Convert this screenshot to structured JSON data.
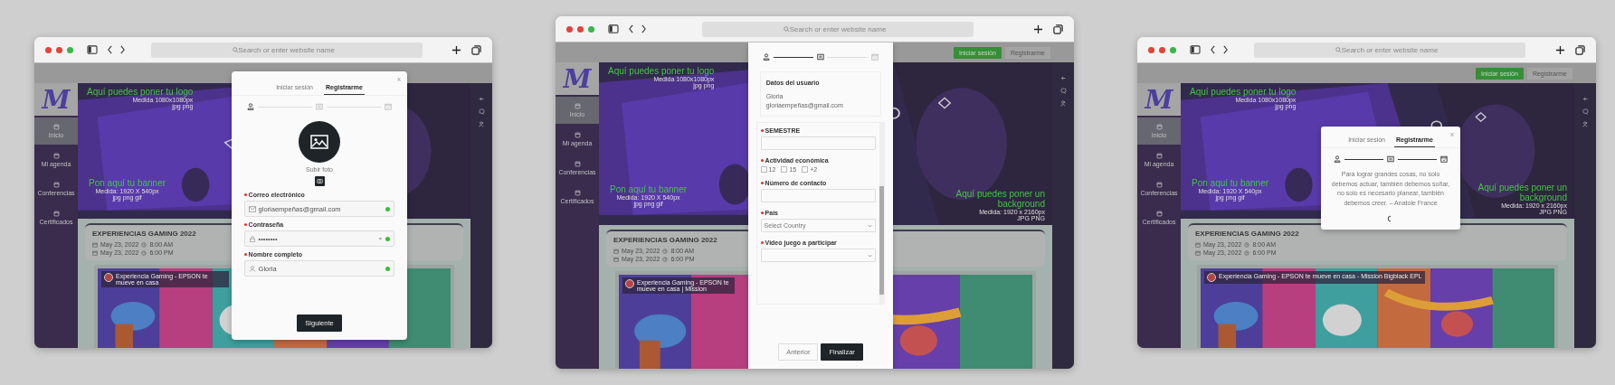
{
  "windows": [
    {
      "address_placeholder": "Search or enter website name",
      "site": {
        "logo": "M",
        "sidebar": [
          {
            "label": "Inicio",
            "selected": true
          },
          {
            "label": "Mi agenda",
            "selected": false
          },
          {
            "label": "Conferencias",
            "selected": false
          },
          {
            "label": "Certificados",
            "selected": false
          }
        ],
        "hero_texts": [
          {
            "kind": "logo",
            "title": "Aquí puedes poner tu logo",
            "size": "Medida 1080x1080px",
            "formats": "jpg png"
          },
          {
            "kind": "banner",
            "title": "Pon aquí tu banner",
            "size": "Medida: 1920 X 540px",
            "formats": "jpg png gif"
          }
        ],
        "event": {
          "title": "EXPERIENCIAS GAMING 2022",
          "start_date": "May 23, 2022",
          "start_time": "8:00 AM",
          "end_date": "May 23, 2022",
          "end_time": "6:00 PM"
        },
        "video_title": "Experiencia Gaming - EPSON te mueve en casa"
      },
      "modal": {
        "close": "x",
        "tabs": [
          {
            "label": "Iniciar sesión",
            "selected": false
          },
          {
            "label": "Registrarme",
            "selected": true
          }
        ],
        "steps": [
          {
            "kind": "user",
            "done": true
          },
          {
            "kind": "card",
            "done": false
          },
          {
            "kind": "calendar",
            "done": false
          }
        ],
        "upload_label": "Subir foto",
        "fields": [
          {
            "kind": "email",
            "label": "Correo electrónico",
            "required": true,
            "value": "gloriaempeñas@gmail.com",
            "valid": true
          },
          {
            "kind": "password",
            "label": "Contraseña",
            "required": true,
            "value": "••••••••",
            "valid": true
          },
          {
            "kind": "name",
            "label": "Nombre completo",
            "required": true,
            "value": "Gloria",
            "valid": true
          }
        ],
        "buttons": [
          {
            "label": "Siguiente",
            "primary": true
          }
        ]
      }
    },
    {
      "address_placeholder": "Search or enter website name",
      "site": {
        "logo": "M",
        "header_buttons": [
          {
            "label": "Iniciar sesión",
            "primary": true
          },
          {
            "label": "Registrarme",
            "primary": false
          }
        ],
        "sidebar": [
          {
            "label": "Inicio",
            "selected": true
          },
          {
            "label": "Mi agenda",
            "selected": false
          },
          {
            "label": "Conferencias",
            "selected": false
          },
          {
            "label": "Certificados",
            "selected": false
          }
        ],
        "hero_texts": [
          {
            "kind": "logo",
            "title": "Aquí puedes poner tu logo",
            "size": "Medida 1080x1080px",
            "formats": "jpg png"
          },
          {
            "kind": "banner",
            "title": "Pon aquí tu banner",
            "size": "Medida: 1920 X 540px",
            "formats": "jpg png gif"
          },
          {
            "kind": "background",
            "title": "Aquí puedes poner un background",
            "size": "Medida: 1920 x 2160px",
            "formats": "JPG PNG"
          }
        ],
        "event": {
          "title": "EXPERIENCIAS GAMING 2022",
          "start_date": "May 23, 2022",
          "start_time": "8:00 AM",
          "end_date": "May 23, 2022",
          "end_time": "6:00 PM"
        },
        "video_title": "Experiencia Gaming - EPSON te mueve en casa | Mission"
      },
      "modal": {
        "kind": "details",
        "steps": [
          {
            "kind": "user",
            "done": true
          },
          {
            "kind": "card",
            "done": true
          },
          {
            "kind": "calendar",
            "done": false
          }
        ],
        "user_card": {
          "title": "Datos del usuario",
          "name": "Gloria",
          "email": "gloriaempeñas@gmail.com"
        },
        "fields": [
          {
            "kind": "text",
            "label": "SEMESTRE",
            "required": true
          },
          {
            "kind": "checks",
            "label": "Actividad económica",
            "required": true,
            "options": [
              {
                "label": "12",
                "checked": false
              },
              {
                "label": "15",
                "checked": false
              },
              {
                "label": "+2",
                "checked": false
              }
            ]
          },
          {
            "kind": "text",
            "label": "Número de contacto",
            "required": true
          },
          {
            "kind": "select",
            "label": "País",
            "required": true,
            "placeholder": "Select Country"
          },
          {
            "kind": "select",
            "label": "Video juego a participar",
            "required": true
          }
        ],
        "buttons": [
          {
            "label": "Anterior",
            "primary": false
          },
          {
            "label": "Finalizar",
            "primary": true
          }
        ]
      }
    },
    {
      "address_placeholder": "Search or enter website name",
      "site": {
        "logo": "M",
        "header_buttons": [
          {
            "label": "Iniciar sesión",
            "primary": true
          },
          {
            "label": "Registrarme",
            "primary": false
          }
        ],
        "sidebar": [
          {
            "label": "Inicio",
            "selected": true
          },
          {
            "label": "Mi agenda",
            "selected": false
          },
          {
            "label": "Conferencias",
            "selected": false
          },
          {
            "label": "Certificados",
            "selected": false
          }
        ],
        "hero_texts": [
          {
            "kind": "logo",
            "title": "Aquí puedes poner tu logo",
            "size": "Medida 1080x1080px",
            "formats": "jpg png"
          },
          {
            "kind": "banner",
            "title": "Pon aquí tu banner",
            "size": "Medida: 1920 X 540px",
            "formats": "jpg png gif"
          },
          {
            "kind": "background",
            "title": "Aquí puedes poner un background",
            "size": "Medida: 1920 x 2160px",
            "formats": "JPG PNG"
          }
        ],
        "event": {
          "title": "EXPERIENCIAS GAMING 2022",
          "start_date": "May 23, 2022",
          "start_time": "8:00 AM",
          "end_date": "May 23, 2022",
          "end_time": "6:00 PM"
        },
        "video_title": "Experiencia Gaming - EPSON te mueve en casa - Mission Bigblack EPL"
      },
      "modal": {
        "kind": "quote",
        "close": "x",
        "tabs": [
          {
            "label": "Iniciar sesión",
            "selected": false
          },
          {
            "label": "Registrarme",
            "selected": true
          }
        ],
        "steps": [
          {
            "kind": "user",
            "done": true
          },
          {
            "kind": "card",
            "done": true
          },
          {
            "kind": "calendar",
            "done": true
          }
        ],
        "quote": "Para lograr grandes cosas, no solo debemos actuar, también debemos soñar, no solo es necesario planear, también debemos creer. – Anatole France",
        "loading": true
      }
    }
  ]
}
